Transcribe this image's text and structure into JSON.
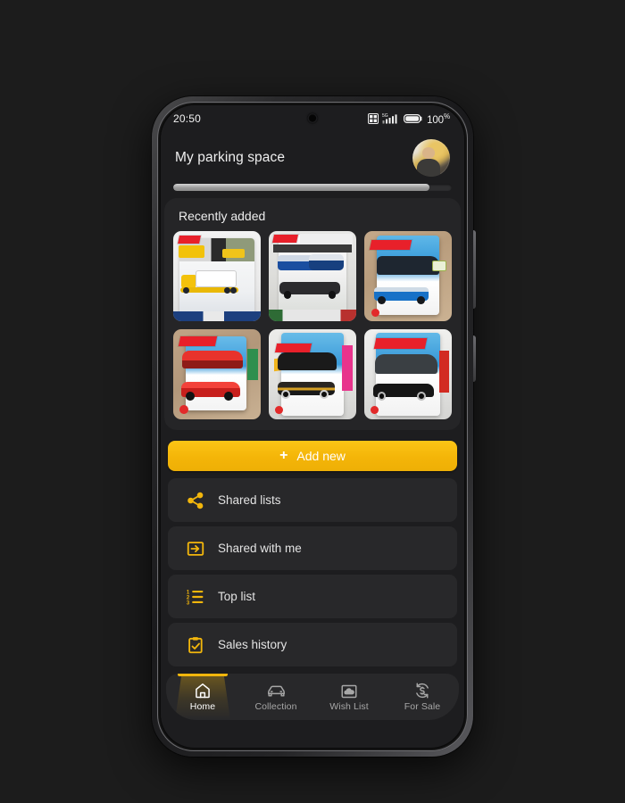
{
  "status_bar": {
    "time": "20:50",
    "network_type": "5G",
    "signal_icon": "signal-bars-icon",
    "sim_icon": "dual-sim-icon",
    "battery_icon": "battery-full-icon",
    "battery_level": "100",
    "battery_unit": "%"
  },
  "header": {
    "title": "My parking space",
    "avatar_name": "user-avatar"
  },
  "scroll": {
    "thumb_percent": "92"
  },
  "recently_added": {
    "section_title": "Recently added",
    "items": [
      {
        "name": "yellow-box-truck-2-pack",
        "brand": "HOT WHEELS"
      },
      {
        "name": "blue-rally-car-premium",
        "brand": "HOT WHEELS"
      },
      {
        "name": "blue-hatchback-mainline",
        "brand": "HOT WHEELS"
      },
      {
        "name": "red-sports-car-mainline",
        "brand": "HOT WHEELS"
      },
      {
        "name": "black-gold-race-car",
        "brand": "HOT WHEELS"
      },
      {
        "name": "dark-grey-muscle-car",
        "brand": "HOT WHEELS"
      }
    ]
  },
  "add_new": {
    "label": "Add new",
    "plus_glyph": "+"
  },
  "menu": {
    "items": [
      {
        "label": "Shared lists",
        "icon": "share-nodes-icon",
        "name": "shared-lists"
      },
      {
        "label": "Shared with me",
        "icon": "arrow-into-box-icon",
        "name": "shared-with-me"
      },
      {
        "label": "Top list",
        "icon": "numbered-list-icon",
        "name": "top-list"
      },
      {
        "label": "Sales history",
        "icon": "clipboard-check-icon",
        "name": "sales-history"
      }
    ]
  },
  "bottom_nav": {
    "items": [
      {
        "label": "Home",
        "icon": "home-icon",
        "active": true
      },
      {
        "label": "Collection",
        "icon": "car-icon",
        "active": false
      },
      {
        "label": "Wish List",
        "icon": "image-cloud-icon",
        "active": false
      },
      {
        "label": "For Sale",
        "icon": "dollar-sync-icon",
        "active": false
      }
    ]
  },
  "colors": {
    "accent": "#F2B60C",
    "accent_button": "#F4B508",
    "screen_bg": "#1D1D1F",
    "card_bg": "#252527",
    "row_bg": "#28282A",
    "text_primary": "#EDEDED",
    "text_secondary": "#A7A7A7",
    "page_bg": "#1C1C1C"
  }
}
